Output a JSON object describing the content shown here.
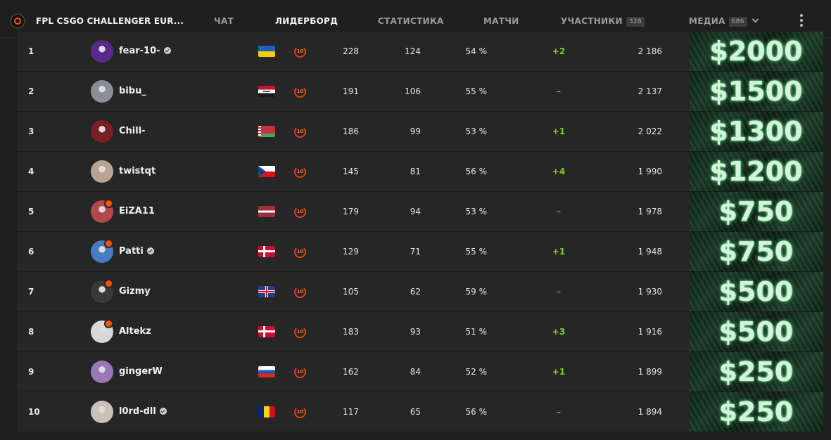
{
  "header": {
    "title": "FPL CSGO CHALLENGER EUR...",
    "tabs": [
      {
        "label": "ЧАТ"
      },
      {
        "label": "ЛИДЕРБОРД"
      },
      {
        "label": "СТАТИСТИКА"
      },
      {
        "label": "МАТЧИ"
      },
      {
        "label": "УЧАСТНИКИ",
        "badge": "328"
      },
      {
        "label": "МЕДИА",
        "badge": "686"
      }
    ],
    "active_tab": "ЛИДЕРБОРД",
    "accent_color": "#ff5500"
  },
  "leaderboard": {
    "rows": [
      {
        "rank": "1",
        "nick": "fear-10-",
        "verified": true,
        "premium": false,
        "flag": "ukraine",
        "level": "10",
        "matches": "228",
        "wins": "124",
        "winrate": "54 %",
        "change": "+2",
        "elo": "2 186",
        "prize": "$2000",
        "avatar": "#5a2a8a"
      },
      {
        "rank": "2",
        "nick": "bibu_",
        "verified": false,
        "premium": false,
        "flag": "iraq",
        "level": "10",
        "matches": "191",
        "wins": "106",
        "winrate": "55 %",
        "change": "–",
        "elo": "2 137",
        "prize": "$1500",
        "avatar": "#8a8f96"
      },
      {
        "rank": "3",
        "nick": "Chill-",
        "verified": false,
        "premium": false,
        "flag": "belarus",
        "level": "10",
        "matches": "186",
        "wins": "99",
        "winrate": "53 %",
        "change": "+1",
        "elo": "2 022",
        "prize": "$1300",
        "avatar": "#7a1f22"
      },
      {
        "rank": "4",
        "nick": "twistqt",
        "verified": false,
        "premium": false,
        "flag": "czech",
        "level": "10",
        "matches": "145",
        "wins": "81",
        "winrate": "56 %",
        "change": "+4",
        "elo": "1 990",
        "prize": "$1200",
        "avatar": "#b9a58f"
      },
      {
        "rank": "5",
        "nick": "EiZA11",
        "verified": false,
        "premium": true,
        "flag": "latvia",
        "level": "10",
        "matches": "179",
        "wins": "94",
        "winrate": "53 %",
        "change": "–",
        "elo": "1 978",
        "prize": "$750",
        "avatar": "#b34a4a"
      },
      {
        "rank": "6",
        "nick": "Patti",
        "verified": true,
        "premium": true,
        "flag": "denmark",
        "level": "10",
        "matches": "129",
        "wins": "71",
        "winrate": "55 %",
        "change": "+1",
        "elo": "1 948",
        "prize": "$750",
        "avatar": "#4a7cc4"
      },
      {
        "rank": "7",
        "nick": "Gizmy",
        "verified": false,
        "premium": true,
        "flag": "uk",
        "level": "10",
        "matches": "105",
        "wins": "62",
        "winrate": "59 %",
        "change": "–",
        "elo": "1 930",
        "prize": "$500",
        "avatar": "#3a3a3a"
      },
      {
        "rank": "8",
        "nick": "Altekz",
        "verified": false,
        "premium": true,
        "flag": "denmark",
        "level": "10",
        "matches": "183",
        "wins": "93",
        "winrate": "51 %",
        "change": "+3",
        "elo": "1 916",
        "prize": "$500",
        "avatar": "#d8d8d8"
      },
      {
        "rank": "9",
        "nick": "gingerW",
        "verified": false,
        "premium": false,
        "flag": "russia",
        "level": "10",
        "matches": "162",
        "wins": "84",
        "winrate": "52 %",
        "change": "+1",
        "elo": "1 899",
        "prize": "$250",
        "avatar": "#9a78b8"
      },
      {
        "rank": "10",
        "nick": "l0rd-dll",
        "verified": true,
        "premium": false,
        "flag": "romania",
        "level": "10",
        "matches": "117",
        "wins": "65",
        "winrate": "56 %",
        "change": "–",
        "elo": "1 894",
        "prize": "$250",
        "avatar": "#c9c2b8"
      }
    ]
  }
}
